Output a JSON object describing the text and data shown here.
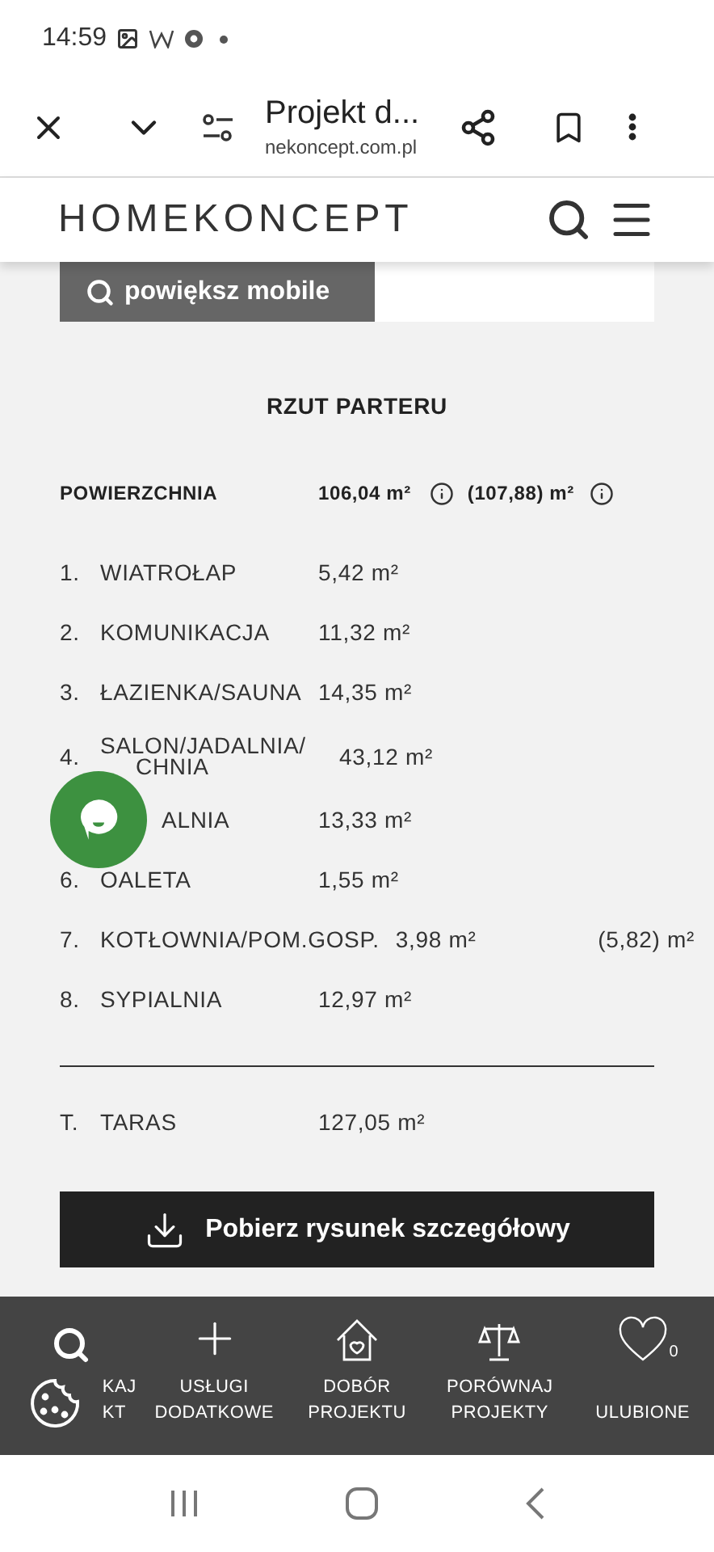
{
  "status_bar": {
    "time": "14:59"
  },
  "browser": {
    "title": "Projekt d...",
    "url": "nekoncept.com.pl"
  },
  "site_header": {
    "logo": "HOMEKONCEPT"
  },
  "zoom_button": {
    "label": "powiększ mobile"
  },
  "heading": "RZUT PARTERU",
  "area_summary": {
    "label": "POWIERZCHNIA",
    "value": "106,04 m²",
    "value_alt": "(107,88) m²"
  },
  "rooms": [
    {
      "number": "1.",
      "name_lines": [
        "WIATROŁAP"
      ],
      "area": "5,42 m²"
    },
    {
      "number": "2.",
      "name_lines": [
        "KOMUNIKACJA"
      ],
      "area": "11,32 m²"
    },
    {
      "number": "3.",
      "name_lines": [
        "ŁAZIENKA/SAUNA"
      ],
      "area": "14,35 m²"
    },
    {
      "number": "4.",
      "name_lines": [
        "SALON/JADALNIA/",
        "CHNIA"
      ],
      "area": "43,12 m²"
    },
    {
      "name_lines": [
        "ALNIA"
      ],
      "area": "13,33 m²"
    },
    {
      "number": "6.",
      "name_lines": [
        "OALETA"
      ],
      "area": "1,55 m²"
    },
    {
      "number": "7.",
      "name_lines": [
        "KOTŁOWNIA/POM.GOSP."
      ],
      "area": "3,98 m²",
      "area_alt": "(5,82) m²"
    },
    {
      "number": "8.",
      "name_lines": [
        "SYPIALNIA"
      ],
      "area": "12,97 m²"
    }
  ],
  "terrace": {
    "number": "T.",
    "name_lines": [
      "TARAS"
    ],
    "area": "127,05 m²"
  },
  "download_button": {
    "label": "Pobierz rysunek szczegółowy"
  },
  "bottom_nav": [
    {
      "kind": "search",
      "label": "KAJ\nKT"
    },
    {
      "kind": "plus",
      "label": "USŁUGI\nDODATKOWE"
    },
    {
      "kind": "house",
      "label": "DOBÓR\nPROJEKTU"
    },
    {
      "kind": "scales",
      "label": "PORÓWNAJ\nPROJEKTY"
    },
    {
      "kind": "heart",
      "label": "ULUBIONE",
      "count": "0"
    }
  ]
}
